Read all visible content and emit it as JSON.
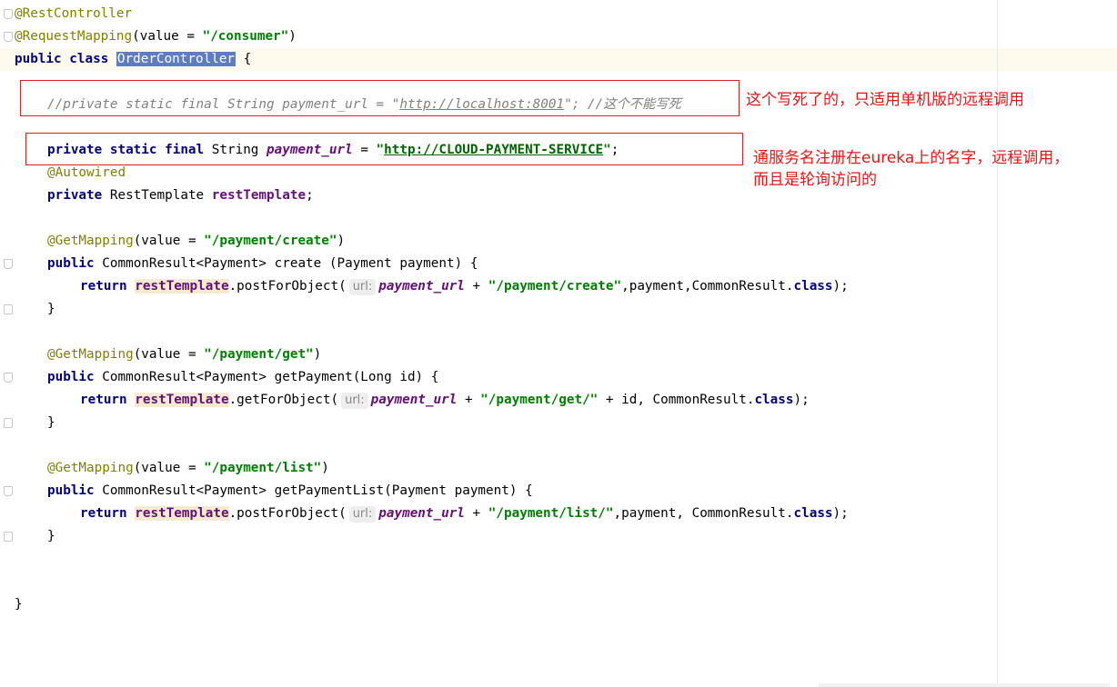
{
  "editor": {
    "lines": {
      "l1": {
        "ann": "@RestController"
      },
      "l2": {
        "ann": "@RequestMapping",
        "pre": "(value = ",
        "str": "\"/consumer\"",
        "post": ")"
      },
      "l3": {
        "kw1": "public",
        "kw2": "class",
        "name": "OrderController",
        "post": " {"
      },
      "l4": {
        "comment_a": "//private static final String payment_url = \"",
        "comment_url": "http://localhost:8001",
        "comment_b": "\"; //这个不能写死"
      },
      "l5": {
        "kw": "private static final",
        "type": " String ",
        "field": "payment_url",
        "eq": " = ",
        "q1": "\"",
        "url": "http://CLOUD-PAYMENT-SERVICE",
        "q2": "\"",
        "end": ";"
      },
      "l6": {
        "ann": "@Autowired"
      },
      "l7": {
        "kw": "private",
        "type": " RestTemplate ",
        "field": "restTemplate",
        "end": ";"
      },
      "l8": {
        "ann": "@GetMapping",
        "pre": "(value = ",
        "str": "\"/payment/create\"",
        "post": ")"
      },
      "l9": {
        "kw": "public",
        "rest": " CommonResult<Payment> create (Payment payment) {"
      },
      "l10": {
        "kw": "return",
        "obj": "restTemplate",
        "method": ".postForObject(",
        "hint": "url:",
        "field": "payment_url",
        "plus": " + ",
        "str": "\"/payment/create\"",
        "rest": ",payment,CommonResult.",
        "cls": "class",
        "end": ");"
      },
      "l11": {
        "brace": "}"
      },
      "l12": {
        "ann": "@GetMapping",
        "pre": "(value = ",
        "str": "\"/payment/get\"",
        "post": ")"
      },
      "l13": {
        "kw": "public",
        "rest": " CommonResult<Payment> getPayment(Long id) {"
      },
      "l14": {
        "kw": "return",
        "obj": "restTemplate",
        "method": ".getForObject(",
        "hint": "url:",
        "field": "payment_url",
        "plus": " + ",
        "str": "\"/payment/get/\"",
        "rest": " + id, CommonResult.",
        "cls": "class",
        "end": ");"
      },
      "l15": {
        "brace": "}"
      },
      "l16": {
        "ann": "@GetMapping",
        "pre": "(value = ",
        "str": "\"/payment/list\"",
        "post": ")"
      },
      "l17": {
        "kw": "public",
        "rest": " CommonResult<Payment> getPaymentList(Payment payment) {"
      },
      "l18": {
        "kw": "return",
        "obj": "restTemplate",
        "method": ".postForObject(",
        "hint": "url:",
        "field": "payment_url",
        "plus": " + ",
        "str": "\"/payment/list/\"",
        "rest": ",payment, CommonResult.",
        "cls": "class",
        "end": ");"
      },
      "l19": {
        "brace": "}"
      },
      "l20": {
        "brace": "}"
      }
    }
  },
  "annotations": {
    "note1": "这个写死了的，只适用单机版的远程调用",
    "note2_line1": "通服务名注册在eureka上的名字，远程调用，",
    "note2_line2": "而且是轮询访问的"
  },
  "colors": {
    "keyword": "#000080",
    "annotation": "#808000",
    "string": "#008000",
    "field": "#660e7a",
    "comment": "#808080",
    "note_red": "#ee1111"
  }
}
